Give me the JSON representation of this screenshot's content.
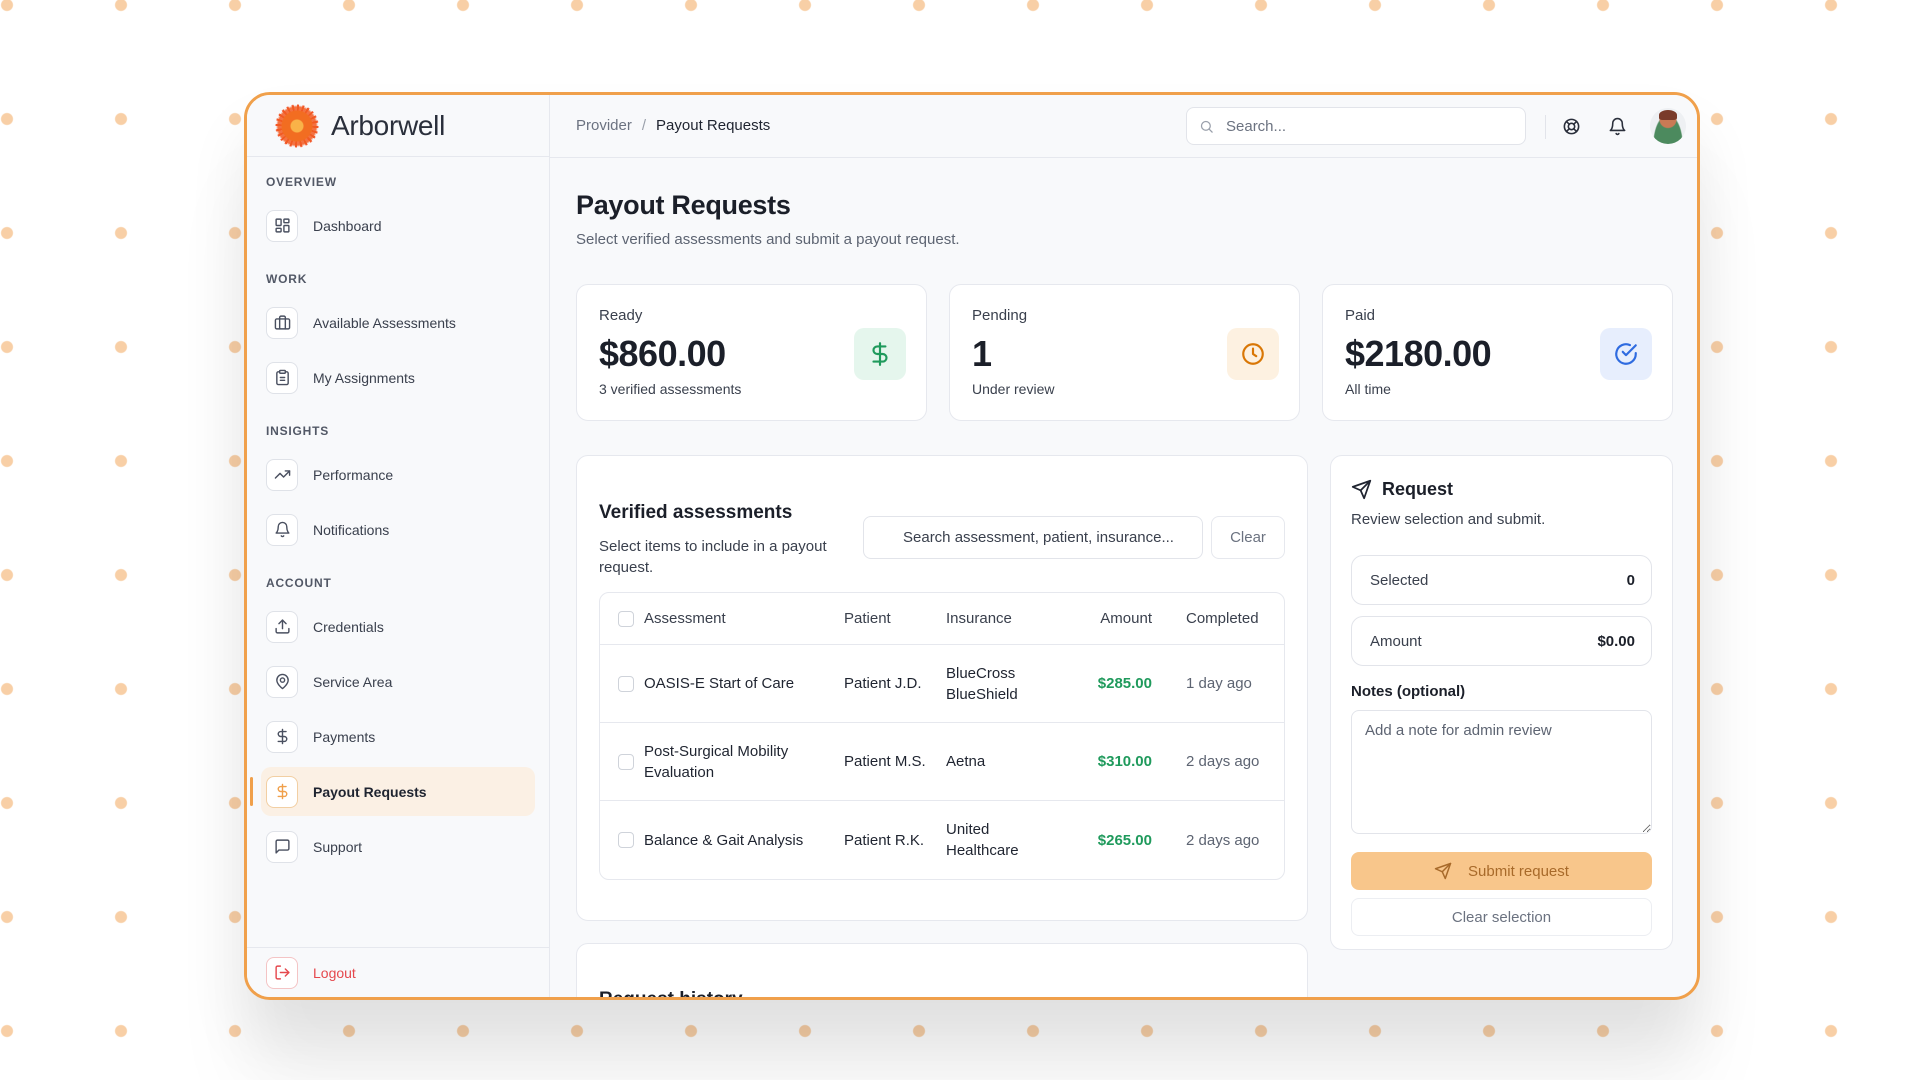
{
  "brand": {
    "name": "Arborwell"
  },
  "sidebar": {
    "sections": {
      "overview": "OVERVIEW",
      "work": "WORK",
      "insights": "INSIGHTS",
      "account": "ACCOUNT"
    },
    "items": {
      "dashboard": {
        "label": "Dashboard",
        "icon": "dashboard-icon"
      },
      "available": {
        "label": "Available Assessments",
        "icon": "briefcase-icon"
      },
      "assignments": {
        "label": "My Assignments",
        "icon": "clipboard-icon"
      },
      "performance": {
        "label": "Performance",
        "icon": "trending-up-icon"
      },
      "notifications": {
        "label": "Notifications",
        "icon": "bell-icon"
      },
      "credentials": {
        "label": "Credentials",
        "icon": "upload-icon"
      },
      "service_area": {
        "label": "Service Area",
        "icon": "map-pin-icon"
      },
      "payments": {
        "label": "Payments",
        "icon": "dollar-icon"
      },
      "payout_requests": {
        "label": "Payout Requests",
        "icon": "dollar-icon",
        "active": true
      },
      "support": {
        "label": "Support",
        "icon": "message-icon"
      }
    },
    "logout": {
      "label": "Logout",
      "icon": "logout-icon"
    }
  },
  "topbar": {
    "breadcrumb": {
      "parent": "Provider",
      "separator": "/",
      "current": "Payout Requests"
    },
    "search_placeholder": "Search..."
  },
  "page": {
    "title": "Payout Requests",
    "subtitle": "Select verified assessments and submit a payout request."
  },
  "stats": {
    "ready": {
      "label": "Ready",
      "value": "$860.00",
      "note": "3 verified assessments",
      "icon": "dollar-icon"
    },
    "pending": {
      "label": "Pending",
      "value": "1",
      "note": "Under review",
      "icon": "clock-icon"
    },
    "paid": {
      "label": "Paid",
      "value": "$2180.00",
      "note": "All time",
      "icon": "check-circle-icon"
    }
  },
  "verified": {
    "title": "Verified assessments",
    "subtitle": "Select items to include in a payout request.",
    "search_placeholder": "Search assessment, patient, insurance...",
    "clear_label": "Clear",
    "columns": {
      "assessment": "Assessment",
      "patient": "Patient",
      "insurance": "Insurance",
      "amount": "Amount",
      "completed": "Completed"
    },
    "rows": [
      {
        "assessment": "OASIS-E Start of Care",
        "patient": "Patient J.D.",
        "insurance": "BlueCross BlueShield",
        "amount": "$285.00",
        "completed": "1 day ago"
      },
      {
        "assessment": "Post-Surgical Mobility Evaluation",
        "patient": "Patient M.S.",
        "insurance": "Aetna",
        "amount": "$310.00",
        "completed": "2 days ago"
      },
      {
        "assessment": "Balance & Gait Analysis",
        "patient": "Patient R.K.",
        "insurance": "United Healthcare",
        "amount": "$265.00",
        "completed": "2 days ago"
      }
    ]
  },
  "request": {
    "title": "Request",
    "subtitle": "Review selection and submit.",
    "selected_label": "Selected",
    "selected_value": "0",
    "amount_label": "Amount",
    "amount_value": "$0.00",
    "notes_label": "Notes (optional)",
    "notes_placeholder": "Add a note for admin review",
    "submit_label": "Submit request",
    "clear_label": "Clear selection"
  },
  "history": {
    "title": "Request history"
  },
  "colors": {
    "accent": "#f0a04b",
    "success": "#1f9a5c",
    "warning": "#d97706",
    "info": "#2f6be0",
    "danger": "#e5484d"
  }
}
